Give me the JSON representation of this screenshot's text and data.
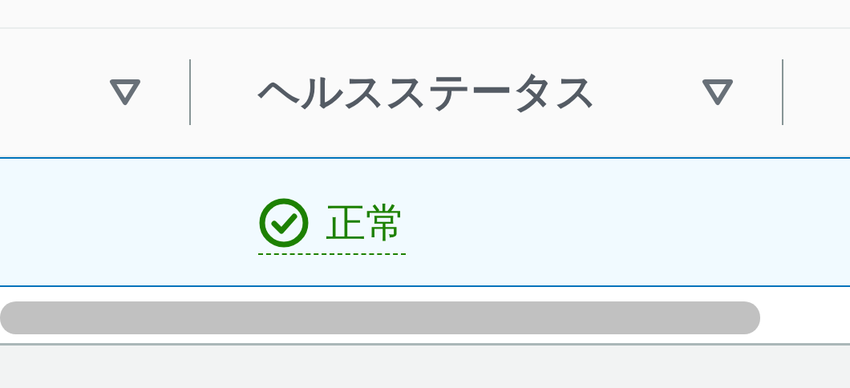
{
  "table": {
    "columns": [
      {
        "sortable": true
      },
      {
        "label": "ヘルスステータス",
        "sortable": true
      }
    ],
    "rows": [
      {
        "selected": true,
        "health_status": {
          "kind": "ok",
          "text": "正常"
        }
      }
    ]
  }
}
